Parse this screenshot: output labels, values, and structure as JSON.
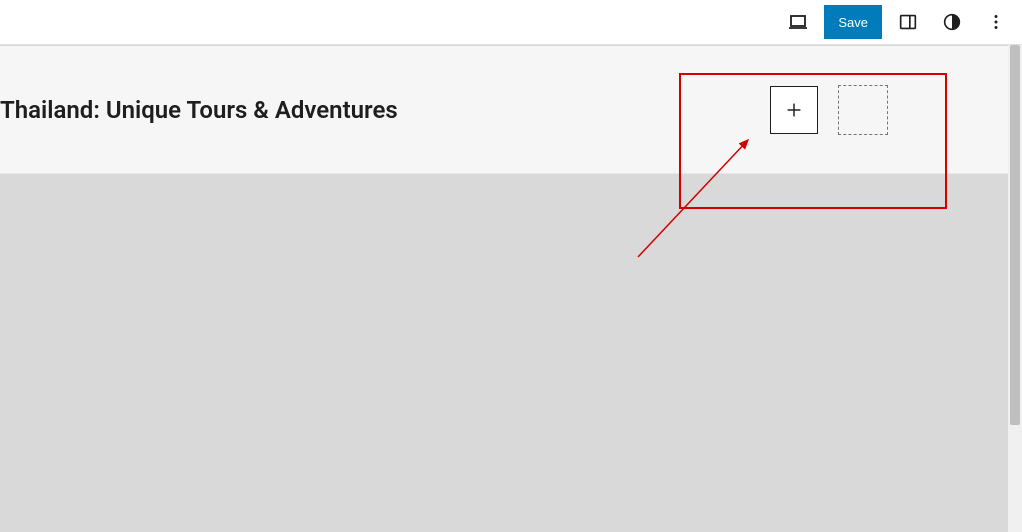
{
  "toolbar": {
    "save_label": "Save"
  },
  "header": {
    "site_title": "Thailand: Unique Tours & Adventures"
  },
  "colors": {
    "primary": "#007cba",
    "annotation": "#d40000"
  }
}
